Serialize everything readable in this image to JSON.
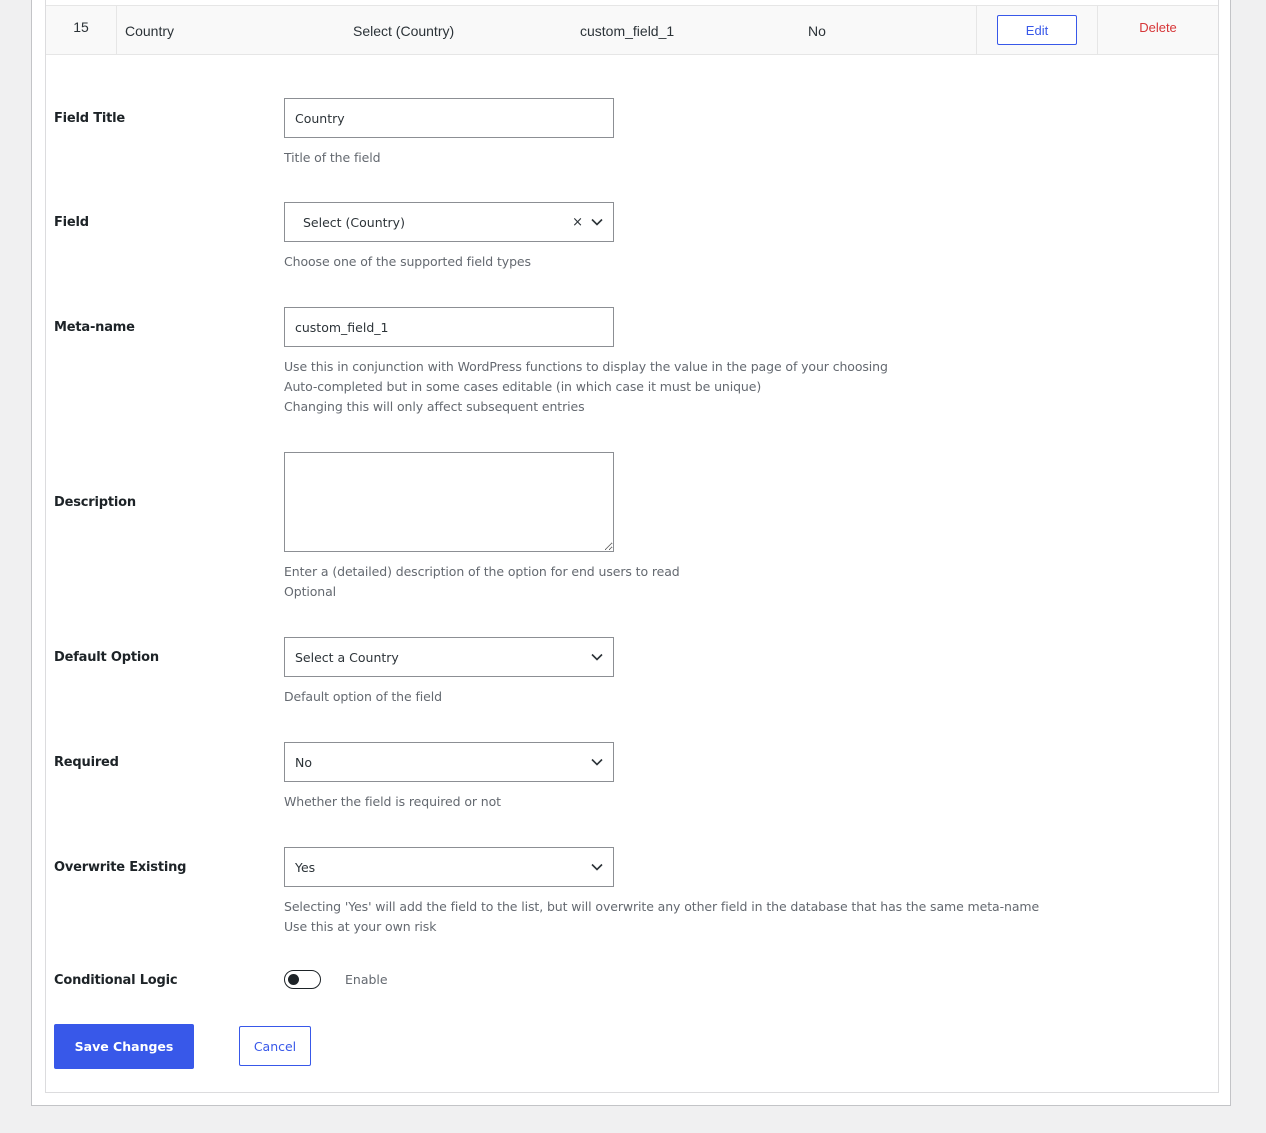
{
  "row": {
    "number": "15",
    "title": "Country",
    "type": "Select (Country)",
    "meta_name": "custom_field_1",
    "required": "No",
    "edit_label": "Edit",
    "delete_label": "Delete"
  },
  "form": {
    "field_title": {
      "label": "Field Title",
      "value": "Country",
      "help": "Title of the field"
    },
    "field": {
      "label": "Field",
      "value": "Select (Country)",
      "clear": "×",
      "help": "Choose one of the supported field types"
    },
    "meta_name": {
      "label": "Meta-name",
      "value": "custom_field_1",
      "help": [
        "Use this in conjunction with WordPress functions to display the value in the page of your choosing",
        "Auto-completed but in some cases editable (in which case it must be unique)",
        "Changing this will only affect subsequent entries"
      ]
    },
    "description": {
      "label": "Description",
      "value": "",
      "help": [
        "Enter a (detailed) description of the option for end users to read",
        "Optional"
      ]
    },
    "default_option": {
      "label": "Default Option",
      "value": "Select a Country",
      "help": "Default option of the field"
    },
    "required": {
      "label": "Required",
      "value": "No",
      "help": "Whether the field is required or not"
    },
    "overwrite_existing": {
      "label": "Overwrite Existing",
      "value": "Yes",
      "help": [
        "Selecting 'Yes' will add the field to the list, but will overwrite any other field in the database that has the same meta-name",
        "Use this at your own risk"
      ]
    },
    "conditional_logic": {
      "label": "Conditional Logic",
      "toggle_label": "Enable",
      "enabled": false
    }
  },
  "actions": {
    "save_label": "Save Changes",
    "cancel_label": "Cancel"
  },
  "colors": {
    "accent": "#3858e9",
    "danger": "#d63638",
    "help_text": "#646970"
  }
}
